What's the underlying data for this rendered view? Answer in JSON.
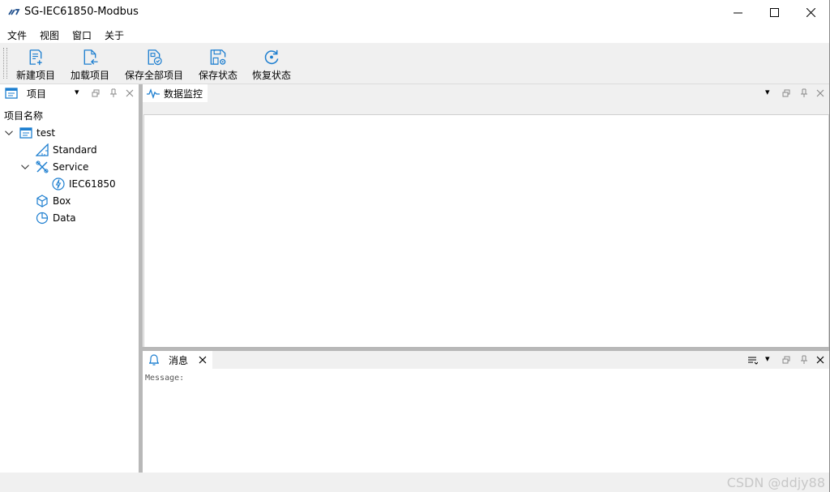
{
  "window": {
    "title": "SG-IEC61850-Modbus",
    "accent": "#1e7fd0"
  },
  "menu": [
    "文件",
    "视图",
    "窗口",
    "关于"
  ],
  "toolbar": {
    "buttons": [
      {
        "label": "新建项目",
        "icon": "new-project-icon"
      },
      {
        "label": "加载项目",
        "icon": "load-project-icon"
      },
      {
        "label": "保存全部项目",
        "icon": "save-all-icon"
      },
      {
        "label": "保存状态",
        "icon": "save-state-icon"
      },
      {
        "label": "恢复状态",
        "icon": "restore-state-icon"
      }
    ]
  },
  "project_panel": {
    "tab_label": "项目",
    "column_header": "项目名称",
    "tree": {
      "root": "test",
      "standard": "Standard",
      "service": "Service",
      "iec": "IEC61850",
      "box": "Box",
      "data": "Data"
    }
  },
  "monitor_panel": {
    "tab_label": "数据监控"
  },
  "message_panel": {
    "tab_label": "消息",
    "content": "Message:"
  },
  "statusbar": {
    "watermark": "CSDN @ddjy88"
  }
}
